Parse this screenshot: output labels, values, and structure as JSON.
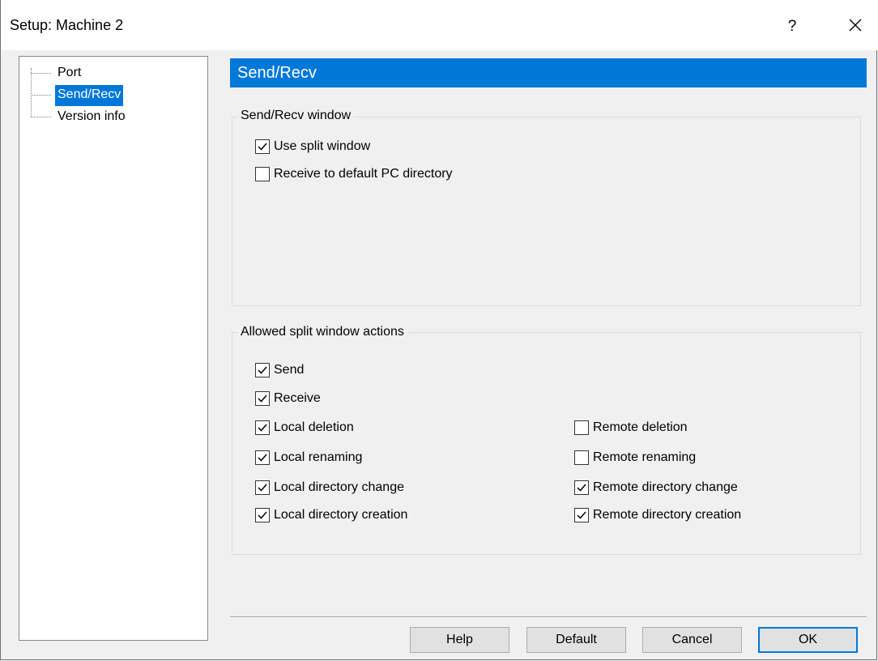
{
  "window": {
    "title": "Setup: Machine 2"
  },
  "titlebar": {
    "help_glyph": "?",
    "close_icon": "close-icon"
  },
  "tree": {
    "items": [
      {
        "label": "Port"
      },
      {
        "label": "Send/Recv",
        "selected": true
      },
      {
        "label": "Version info"
      }
    ]
  },
  "panel": {
    "header": "Send/Recv",
    "groups": [
      {
        "title": "Send/Recv window",
        "options": [
          {
            "label": "Use split window",
            "checked": true
          },
          {
            "label": "Receive to default PC directory",
            "checked": false
          }
        ]
      },
      {
        "title": "Allowed split window actions",
        "options_left": [
          {
            "label": "Send",
            "checked": true
          },
          {
            "label": "Receive",
            "checked": true
          },
          {
            "label": "Local deletion",
            "checked": true
          },
          {
            "label": "Local renaming",
            "checked": true
          },
          {
            "label": "Local directory change",
            "checked": true
          },
          {
            "label": "Local directory creation",
            "checked": true
          }
        ],
        "options_right": [
          {
            "label": "Remote deletion",
            "checked": false
          },
          {
            "label": "Remote renaming",
            "checked": false
          },
          {
            "label": "Remote directory change",
            "checked": true
          },
          {
            "label": "Remote directory creation",
            "checked": true
          }
        ]
      }
    ]
  },
  "buttons": {
    "help": "Help",
    "default": "Default",
    "cancel": "Cancel",
    "ok": "OK"
  },
  "colors": {
    "accent": "#0078d7",
    "background": "#f0f0f0"
  }
}
